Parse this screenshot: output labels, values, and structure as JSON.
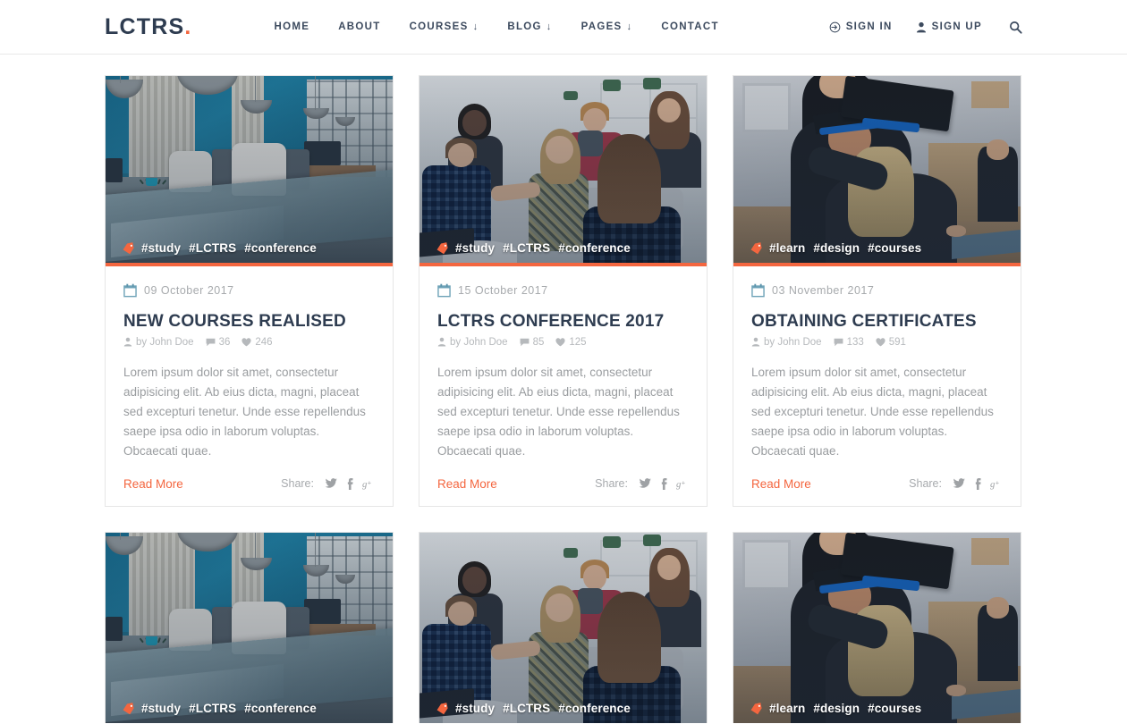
{
  "header": {
    "brand": "LCTRS",
    "brand_dot": ".",
    "nav": [
      {
        "label": "HOME",
        "has_dropdown": false
      },
      {
        "label": "ABOUT",
        "has_dropdown": false
      },
      {
        "label": "COURSES",
        "has_dropdown": true,
        "arrow": "↓"
      },
      {
        "label": "BLOG",
        "has_dropdown": true,
        "arrow": "↓"
      },
      {
        "label": "PAGES",
        "has_dropdown": true,
        "arrow": "↓"
      },
      {
        "label": "CONTACT",
        "has_dropdown": false
      }
    ],
    "sign_in": "SIGN IN",
    "sign_up": "SIGN UP",
    "search_icon": "search-icon"
  },
  "colors": {
    "accent": "#f4663f",
    "heading": "#2e3c50",
    "muted": "#a7aaad",
    "border": "#e6e6e6"
  },
  "labels": {
    "share": "Share:",
    "read_more": "Read More",
    "by_prefix": "by"
  },
  "posts": [
    {
      "id": "post-1",
      "photo": "office",
      "tags": [
        "#study",
        "#LCTRS",
        "#conference"
      ],
      "date": "09 October 2017",
      "title": "NEW COURSES REALISED",
      "author": "by John Doe",
      "comments": "36",
      "likes": "246",
      "excerpt": "Lorem ipsum dolor sit amet, consectetur adipisicing elit. Ab eius dicta, magni, placeat sed excepturi tenetur. Unde esse repellendus saepe ipsa odio in laborum voluptas. Obcaecati quae.",
      "read_more": "Read More",
      "share_label": "Share:"
    },
    {
      "id": "post-2",
      "photo": "meeting",
      "tags": [
        "#study",
        "#LCTRS",
        "#conference"
      ],
      "date": "15 October 2017",
      "title": "LCTRS CONFERENCE 2017",
      "author": "by John Doe",
      "comments": "85",
      "likes": "125",
      "excerpt": "Lorem ipsum dolor sit amet, consectetur adipisicing elit. Ab eius dicta, magni, placeat sed excepturi tenetur. Unde esse repellendus saepe ipsa odio in laborum voluptas. Obcaecati quae.",
      "read_more": "Read More",
      "share_label": "Share:"
    },
    {
      "id": "post-3",
      "photo": "graduation",
      "tags": [
        "#learn",
        "#design",
        "#courses"
      ],
      "date": "03 November 2017",
      "title": "OBTAINING CERTIFICATES",
      "author": "by John Doe",
      "comments": "133",
      "likes": "591",
      "excerpt": "Lorem ipsum dolor sit amet, consectetur adipisicing elit. Ab eius dicta, magni, placeat sed excepturi tenetur. Unde esse repellendus saepe ipsa odio in laborum voluptas. Obcaecati quae.",
      "read_more": "Read More",
      "share_label": "Share:"
    }
  ],
  "posts_row2": [
    {
      "id": "post-4",
      "photo": "office",
      "tags": [
        "#study",
        "#LCTRS",
        "#conference"
      ]
    },
    {
      "id": "post-5",
      "photo": "meeting",
      "tags": [
        "#study",
        "#LCTRS",
        "#conference"
      ]
    },
    {
      "id": "post-6",
      "photo": "graduation",
      "tags": [
        "#learn",
        "#design",
        "#courses"
      ]
    }
  ]
}
